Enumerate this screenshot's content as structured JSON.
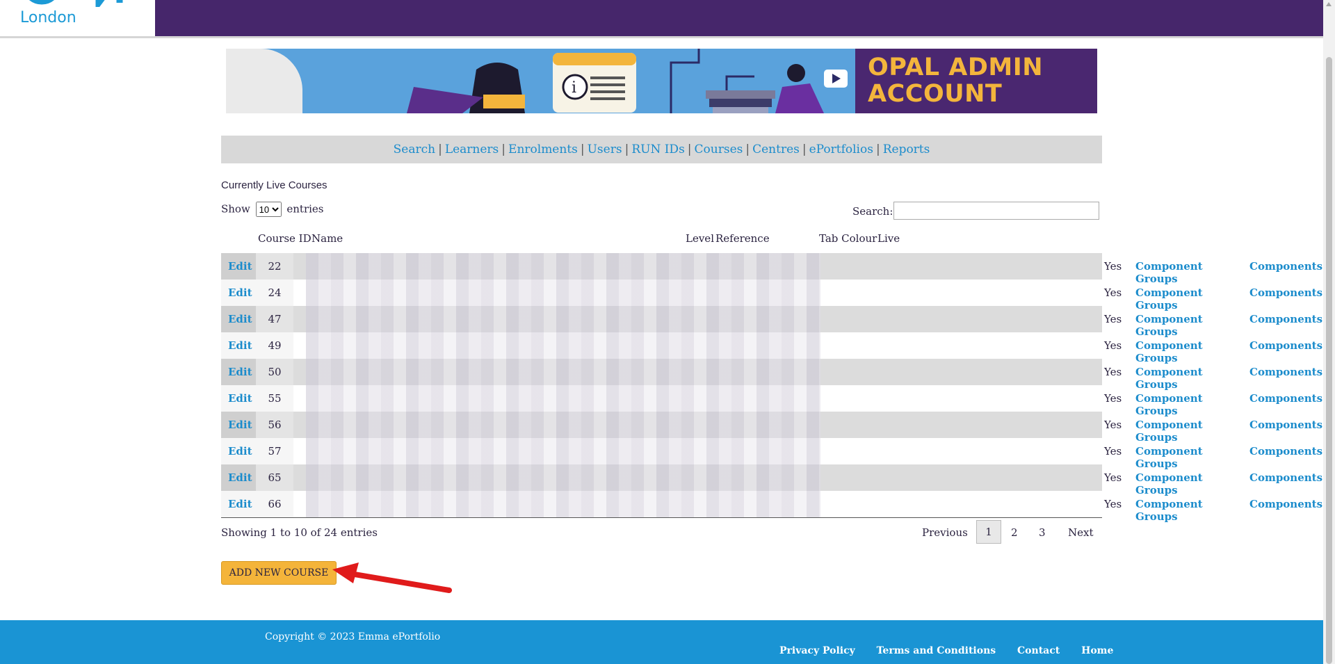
{
  "header": {
    "logo_text": "London"
  },
  "banner": {
    "line1": "OPAL ADMIN",
    "line2": "ACCOUNT",
    "accent": "#f3b53c",
    "brand_purple": "#46266b"
  },
  "nav": {
    "items": [
      "Search",
      "Learners",
      "Enrolments",
      "Users",
      "RUN IDs",
      "Courses",
      "Centres",
      "ePortfolios",
      "Reports"
    ],
    "separator": "|"
  },
  "table": {
    "title": "Currently Live Courses",
    "length_prefix": "Show",
    "length_value": "10",
    "length_suffix": "entries",
    "search_label": "Search:",
    "search_value": "",
    "headers": {
      "course_id": "Course ID",
      "name": "Name",
      "level": "Level",
      "reference": "Reference",
      "tab_colour": "Tab Colour",
      "live": "Live"
    },
    "rows": [
      {
        "edit": "Edit",
        "id": "22",
        "live": "Yes",
        "groups": "Component Groups",
        "components": "Components"
      },
      {
        "edit": "Edit",
        "id": "24",
        "live": "Yes",
        "groups": "Component Groups",
        "components": "Components"
      },
      {
        "edit": "Edit",
        "id": "47",
        "live": "Yes",
        "groups": "Component Groups",
        "components": "Components"
      },
      {
        "edit": "Edit",
        "id": "49",
        "live": "Yes",
        "groups": "Component Groups",
        "components": "Components"
      },
      {
        "edit": "Edit",
        "id": "50",
        "live": "Yes",
        "groups": "Component Groups",
        "components": "Components"
      },
      {
        "edit": "Edit",
        "id": "55",
        "live": "Yes",
        "groups": "Component Groups",
        "components": "Components"
      },
      {
        "edit": "Edit",
        "id": "56",
        "live": "Yes",
        "groups": "Component Groups",
        "components": "Components"
      },
      {
        "edit": "Edit",
        "id": "57",
        "live": "Yes",
        "groups": "Component Groups",
        "components": "Components"
      },
      {
        "edit": "Edit",
        "id": "65",
        "live": "Yes",
        "groups": "Component Groups",
        "components": "Components"
      },
      {
        "edit": "Edit",
        "id": "66",
        "live": "Yes",
        "groups": "Component Groups",
        "components": "Components"
      }
    ],
    "info": "Showing 1 to 10 of 24 entries",
    "pagination": {
      "previous": "Previous",
      "pages": [
        "1",
        "2",
        "3"
      ],
      "current": "1",
      "next": "Next"
    }
  },
  "add_button": "ADD NEW COURSE",
  "footer": {
    "copyright": "Copyright © 2023 Emma ePortfolio",
    "links": [
      "Privacy Policy",
      "Terms and Conditions",
      "Contact",
      "Home"
    ]
  }
}
